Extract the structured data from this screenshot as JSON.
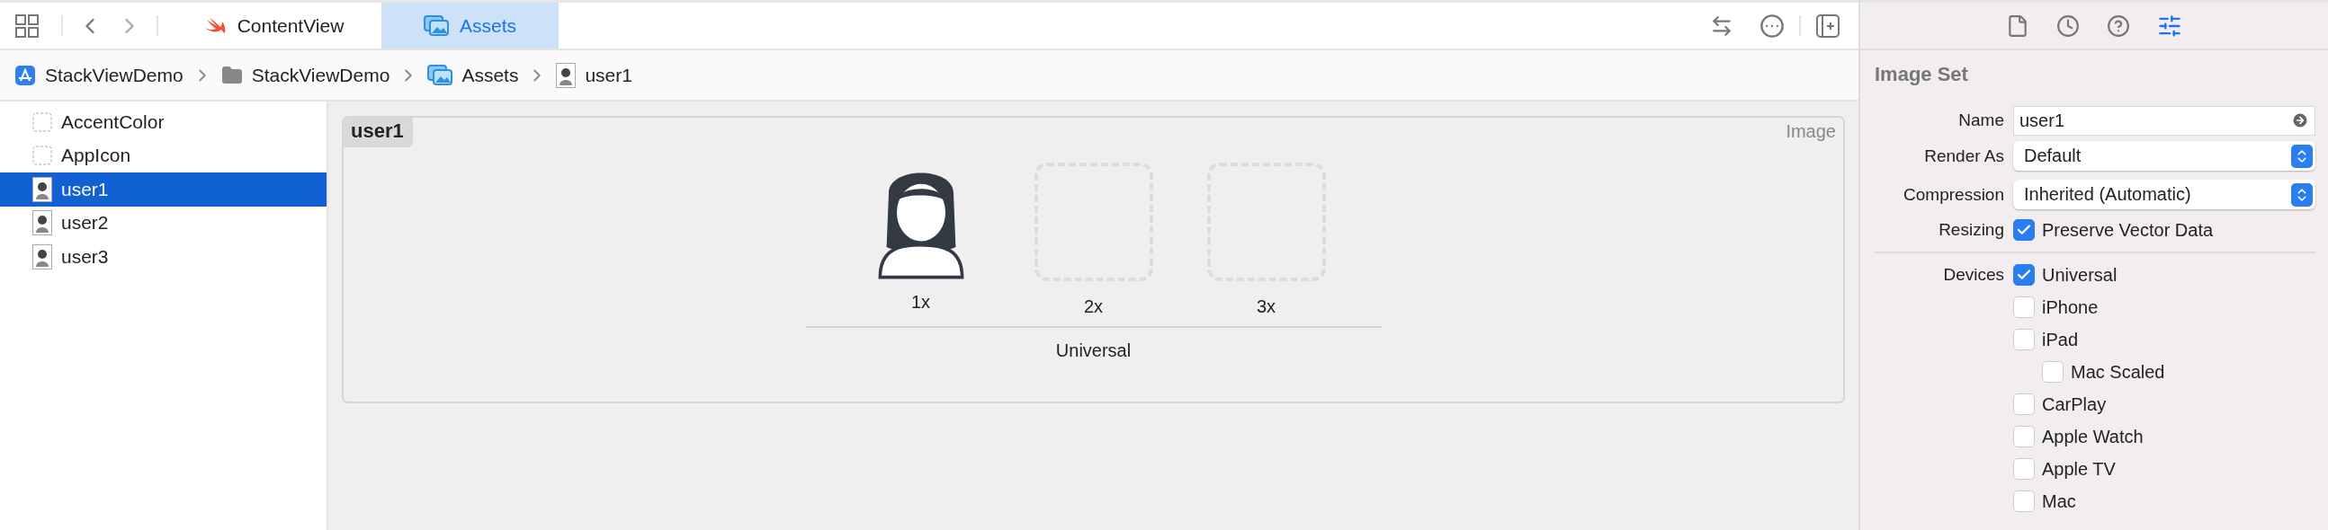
{
  "editor_tabs": [
    {
      "label": "ContentView",
      "kind": "swift",
      "selected": false
    },
    {
      "label": "Assets",
      "kind": "assets",
      "selected": true
    }
  ],
  "breadcrumb": [
    {
      "label": "StackViewDemo",
      "kind": "app"
    },
    {
      "label": "StackViewDemo",
      "kind": "folder"
    },
    {
      "label": "Assets",
      "kind": "assets"
    },
    {
      "label": "user1",
      "kind": "image"
    }
  ],
  "sidebar": {
    "items": [
      {
        "label": "AccentColor",
        "kind": "empty",
        "selected": false
      },
      {
        "label": "AppIcon",
        "kind": "empty",
        "selected": false
      },
      {
        "label": "user1",
        "kind": "image",
        "selected": true
      },
      {
        "label": "user2",
        "kind": "image",
        "selected": false
      },
      {
        "label": "user3",
        "kind": "image",
        "selected": false
      }
    ]
  },
  "asset_card": {
    "title": "user1",
    "type_label": "Image",
    "slots": [
      {
        "label": "1x",
        "kind": "image"
      },
      {
        "label": "2x",
        "kind": "empty"
      },
      {
        "label": "3x",
        "kind": "empty"
      }
    ],
    "group_label": "Universal"
  },
  "inspector_tabs": [
    {
      "kind": "file",
      "selected": false
    },
    {
      "kind": "history",
      "selected": false
    },
    {
      "kind": "help",
      "selected": false
    },
    {
      "kind": "attributes",
      "selected": true
    }
  ],
  "inspector": {
    "title": "Image Set",
    "fields": [
      {
        "label": "Name",
        "kind": "text",
        "value": "user1"
      },
      {
        "label": "Render As",
        "kind": "select",
        "value": "Default"
      },
      {
        "label": "Compression",
        "kind": "select",
        "value": "Inherited (Automatic)"
      },
      {
        "label": "Resizing",
        "kind": "checkbox",
        "value": "Preserve Vector Data",
        "checked": true
      }
    ],
    "devices": {
      "label": "Devices",
      "options": [
        {
          "label": "Universal",
          "checked": true
        },
        {
          "label": "iPhone",
          "checked": false
        },
        {
          "label": "iPad",
          "checked": false,
          "children": [
            {
              "label": "Mac Scaled",
              "checked": false
            }
          ]
        },
        {
          "label": "CarPlay",
          "checked": false
        },
        {
          "label": "Apple Watch",
          "checked": false
        },
        {
          "label": "Apple TV",
          "checked": false
        },
        {
          "label": "Mac",
          "checked": false
        }
      ]
    }
  }
}
